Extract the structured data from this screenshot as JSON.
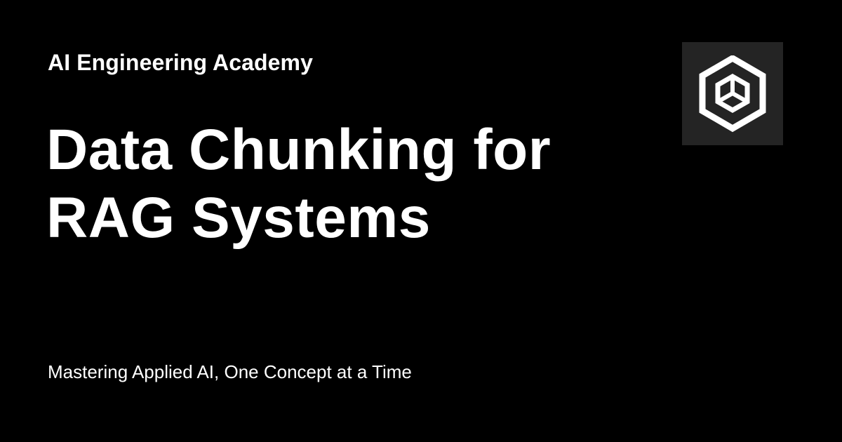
{
  "header": {
    "site_name": "AI Engineering Academy"
  },
  "hero": {
    "title": "Data Chunking for RAG Systems",
    "tagline": "Mastering Applied AI, One Concept at a Time"
  },
  "logo": {
    "icon": "hexagon-cube-logo-icon"
  },
  "colors": {
    "background": "#000000",
    "logo_tile": "#242424",
    "text": "#ffffff"
  }
}
